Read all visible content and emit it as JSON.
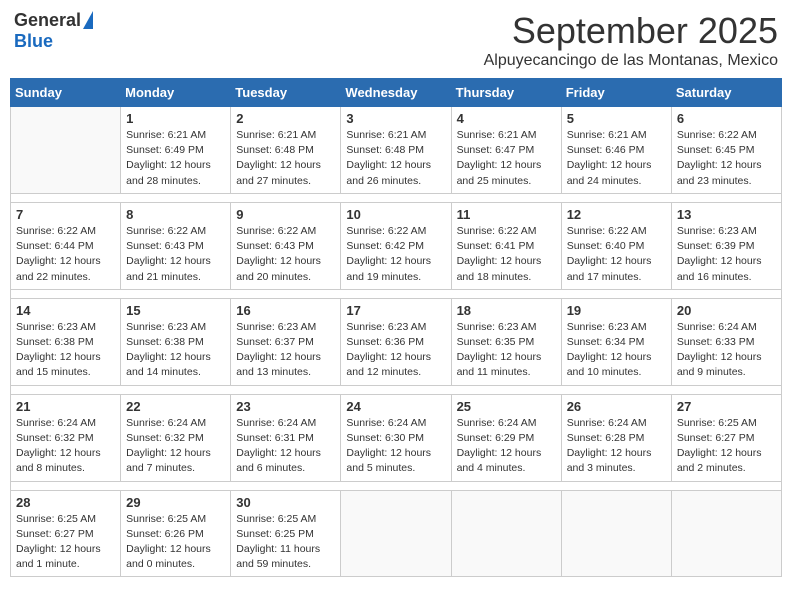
{
  "logo": {
    "general": "General",
    "blue": "Blue"
  },
  "header": {
    "month": "September 2025",
    "location": "Alpuyecancingo de las Montanas, Mexico"
  },
  "days_of_week": [
    "Sunday",
    "Monday",
    "Tuesday",
    "Wednesday",
    "Thursday",
    "Friday",
    "Saturday"
  ],
  "weeks": [
    [
      {
        "day": "",
        "info": ""
      },
      {
        "day": "1",
        "info": "Sunrise: 6:21 AM\nSunset: 6:49 PM\nDaylight: 12 hours\nand 28 minutes."
      },
      {
        "day": "2",
        "info": "Sunrise: 6:21 AM\nSunset: 6:48 PM\nDaylight: 12 hours\nand 27 minutes."
      },
      {
        "day": "3",
        "info": "Sunrise: 6:21 AM\nSunset: 6:48 PM\nDaylight: 12 hours\nand 26 minutes."
      },
      {
        "day": "4",
        "info": "Sunrise: 6:21 AM\nSunset: 6:47 PM\nDaylight: 12 hours\nand 25 minutes."
      },
      {
        "day": "5",
        "info": "Sunrise: 6:21 AM\nSunset: 6:46 PM\nDaylight: 12 hours\nand 24 minutes."
      },
      {
        "day": "6",
        "info": "Sunrise: 6:22 AM\nSunset: 6:45 PM\nDaylight: 12 hours\nand 23 minutes."
      }
    ],
    [
      {
        "day": "7",
        "info": "Sunrise: 6:22 AM\nSunset: 6:44 PM\nDaylight: 12 hours\nand 22 minutes."
      },
      {
        "day": "8",
        "info": "Sunrise: 6:22 AM\nSunset: 6:43 PM\nDaylight: 12 hours\nand 21 minutes."
      },
      {
        "day": "9",
        "info": "Sunrise: 6:22 AM\nSunset: 6:43 PM\nDaylight: 12 hours\nand 20 minutes."
      },
      {
        "day": "10",
        "info": "Sunrise: 6:22 AM\nSunset: 6:42 PM\nDaylight: 12 hours\nand 19 minutes."
      },
      {
        "day": "11",
        "info": "Sunrise: 6:22 AM\nSunset: 6:41 PM\nDaylight: 12 hours\nand 18 minutes."
      },
      {
        "day": "12",
        "info": "Sunrise: 6:22 AM\nSunset: 6:40 PM\nDaylight: 12 hours\nand 17 minutes."
      },
      {
        "day": "13",
        "info": "Sunrise: 6:23 AM\nSunset: 6:39 PM\nDaylight: 12 hours\nand 16 minutes."
      }
    ],
    [
      {
        "day": "14",
        "info": "Sunrise: 6:23 AM\nSunset: 6:38 PM\nDaylight: 12 hours\nand 15 minutes."
      },
      {
        "day": "15",
        "info": "Sunrise: 6:23 AM\nSunset: 6:38 PM\nDaylight: 12 hours\nand 14 minutes."
      },
      {
        "day": "16",
        "info": "Sunrise: 6:23 AM\nSunset: 6:37 PM\nDaylight: 12 hours\nand 13 minutes."
      },
      {
        "day": "17",
        "info": "Sunrise: 6:23 AM\nSunset: 6:36 PM\nDaylight: 12 hours\nand 12 minutes."
      },
      {
        "day": "18",
        "info": "Sunrise: 6:23 AM\nSunset: 6:35 PM\nDaylight: 12 hours\nand 11 minutes."
      },
      {
        "day": "19",
        "info": "Sunrise: 6:23 AM\nSunset: 6:34 PM\nDaylight: 12 hours\nand 10 minutes."
      },
      {
        "day": "20",
        "info": "Sunrise: 6:24 AM\nSunset: 6:33 PM\nDaylight: 12 hours\nand 9 minutes."
      }
    ],
    [
      {
        "day": "21",
        "info": "Sunrise: 6:24 AM\nSunset: 6:32 PM\nDaylight: 12 hours\nand 8 minutes."
      },
      {
        "day": "22",
        "info": "Sunrise: 6:24 AM\nSunset: 6:32 PM\nDaylight: 12 hours\nand 7 minutes."
      },
      {
        "day": "23",
        "info": "Sunrise: 6:24 AM\nSunset: 6:31 PM\nDaylight: 12 hours\nand 6 minutes."
      },
      {
        "day": "24",
        "info": "Sunrise: 6:24 AM\nSunset: 6:30 PM\nDaylight: 12 hours\nand 5 minutes."
      },
      {
        "day": "25",
        "info": "Sunrise: 6:24 AM\nSunset: 6:29 PM\nDaylight: 12 hours\nand 4 minutes."
      },
      {
        "day": "26",
        "info": "Sunrise: 6:24 AM\nSunset: 6:28 PM\nDaylight: 12 hours\nand 3 minutes."
      },
      {
        "day": "27",
        "info": "Sunrise: 6:25 AM\nSunset: 6:27 PM\nDaylight: 12 hours\nand 2 minutes."
      }
    ],
    [
      {
        "day": "28",
        "info": "Sunrise: 6:25 AM\nSunset: 6:27 PM\nDaylight: 12 hours\nand 1 minute."
      },
      {
        "day": "29",
        "info": "Sunrise: 6:25 AM\nSunset: 6:26 PM\nDaylight: 12 hours\nand 0 minutes."
      },
      {
        "day": "30",
        "info": "Sunrise: 6:25 AM\nSunset: 6:25 PM\nDaylight: 11 hours\nand 59 minutes."
      },
      {
        "day": "",
        "info": ""
      },
      {
        "day": "",
        "info": ""
      },
      {
        "day": "",
        "info": ""
      },
      {
        "day": "",
        "info": ""
      }
    ]
  ]
}
